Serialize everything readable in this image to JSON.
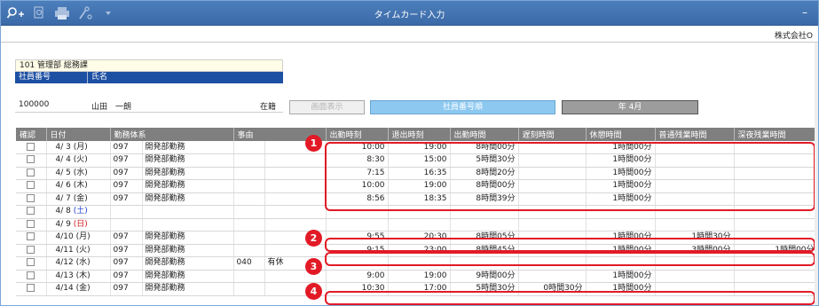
{
  "window": {
    "title": "タイムカード入力",
    "minimize": "–"
  },
  "toolbar": [
    "search-add-icon",
    "zoom-icon",
    "print-icon",
    "tool-icon",
    "dropdown-icon"
  ],
  "header": {
    "company": "株式会社O"
  },
  "employee": {
    "dept": "101 管理部 総務課",
    "col_number": "社員番号",
    "col_name": "氏名",
    "number": "100000",
    "name": "山田　一朗",
    "status": "在籍"
  },
  "buttons": {
    "display": "画面表示",
    "order": "社員番号順",
    "year": "年 4月"
  },
  "table": {
    "headers": [
      "確認",
      "日付",
      "勤務体系",
      "",
      "事由",
      "",
      "出勤時刻",
      "退出時刻",
      "出勤時間",
      "遅刻時間",
      "休憩時間",
      "普通残業時間",
      "深夜残業時間"
    ],
    "rows": [
      {
        "date": "4/ 3",
        "dow": "(月)",
        "dt": "",
        "code": "097",
        "work": "開発部勤務",
        "rcode": "",
        "reason": "",
        "in": "10:00",
        "out": "19:00",
        "wtime": "8時間00分",
        "late": "",
        "brk": "1時間00分",
        "ot": "",
        "night": ""
      },
      {
        "date": "4/ 4",
        "dow": "(火)",
        "dt": "",
        "code": "097",
        "work": "開発部勤務",
        "rcode": "",
        "reason": "",
        "in": "8:30",
        "out": "15:00",
        "wtime": "5時間30分",
        "late": "",
        "brk": "1時間00分",
        "ot": "",
        "night": ""
      },
      {
        "date": "4/ 5",
        "dow": "(水)",
        "dt": "",
        "code": "097",
        "work": "開発部勤務",
        "rcode": "",
        "reason": "",
        "in": "7:15",
        "out": "16:35",
        "wtime": "8時間20分",
        "late": "",
        "brk": "1時間00分",
        "ot": "",
        "night": ""
      },
      {
        "date": "4/ 6",
        "dow": "(木)",
        "dt": "",
        "code": "097",
        "work": "開発部勤務",
        "rcode": "",
        "reason": "",
        "in": "10:00",
        "out": "19:00",
        "wtime": "8時間00分",
        "late": "",
        "brk": "1時間00分",
        "ot": "",
        "night": ""
      },
      {
        "date": "4/ 7",
        "dow": "(金)",
        "dt": "",
        "code": "097",
        "work": "開発部勤務",
        "rcode": "",
        "reason": "",
        "in": "8:56",
        "out": "18:35",
        "wtime": "8時間39分",
        "late": "",
        "brk": "1時間00分",
        "ot": "",
        "night": ""
      },
      {
        "date": "4/ 8",
        "dow": "(土)",
        "dt": "sat",
        "code": "",
        "work": "",
        "rcode": "",
        "reason": "",
        "in": "",
        "out": "",
        "wtime": "",
        "late": "",
        "brk": "",
        "ot": "",
        "night": ""
      },
      {
        "date": "4/ 9",
        "dow": "(日)",
        "dt": "sun",
        "code": "",
        "work": "",
        "rcode": "",
        "reason": "",
        "in": "",
        "out": "",
        "wtime": "",
        "late": "",
        "brk": "",
        "ot": "",
        "night": ""
      },
      {
        "date": "4/10",
        "dow": "(月)",
        "dt": "",
        "code": "097",
        "work": "開発部勤務",
        "rcode": "",
        "reason": "",
        "in": "9:55",
        "out": "20:30",
        "wtime": "8時間05分",
        "late": "",
        "brk": "1時間00分",
        "ot": "1時間30分",
        "night": ""
      },
      {
        "date": "4/11",
        "dow": "(火)",
        "dt": "",
        "code": "097",
        "work": "開発部勤務",
        "rcode": "",
        "reason": "",
        "in": "9:15",
        "out": "23:00",
        "wtime": "8時間45分",
        "late": "",
        "brk": "1時間00分",
        "ot": "3時間00分",
        "night": "1時間00分"
      },
      {
        "date": "4/12",
        "dow": "(水)",
        "dt": "",
        "code": "097",
        "work": "開発部勤務",
        "rcode": "040",
        "reason": "有休",
        "in": "",
        "out": "",
        "wtime": "",
        "late": "",
        "brk": "",
        "ot": "",
        "night": ""
      },
      {
        "date": "4/13",
        "dow": "(木)",
        "dt": "",
        "code": "097",
        "work": "開発部勤務",
        "rcode": "",
        "reason": "",
        "in": "9:00",
        "out": "19:00",
        "wtime": "9時間00分",
        "late": "",
        "brk": "1時間00分",
        "ot": "",
        "night": ""
      },
      {
        "date": "4/14",
        "dow": "(金)",
        "dt": "",
        "code": "097",
        "work": "開発部勤務",
        "rcode": "",
        "reason": "",
        "in": "10:30",
        "out": "17:00",
        "wtime": "5時間30分",
        "late": "0時間30分",
        "brk": "1時間00分",
        "ot": "",
        "night": ""
      }
    ]
  },
  "callouts": [
    "1",
    "2",
    "3",
    "4"
  ],
  "colors": {
    "titlebar": "#3b6aa7",
    "highlight": "#e21a26",
    "header_bg": "#7f7f7f",
    "employee_header": "#1d4fa3",
    "saturday": "#1a3fd1",
    "sunday": "#d81b1b"
  }
}
